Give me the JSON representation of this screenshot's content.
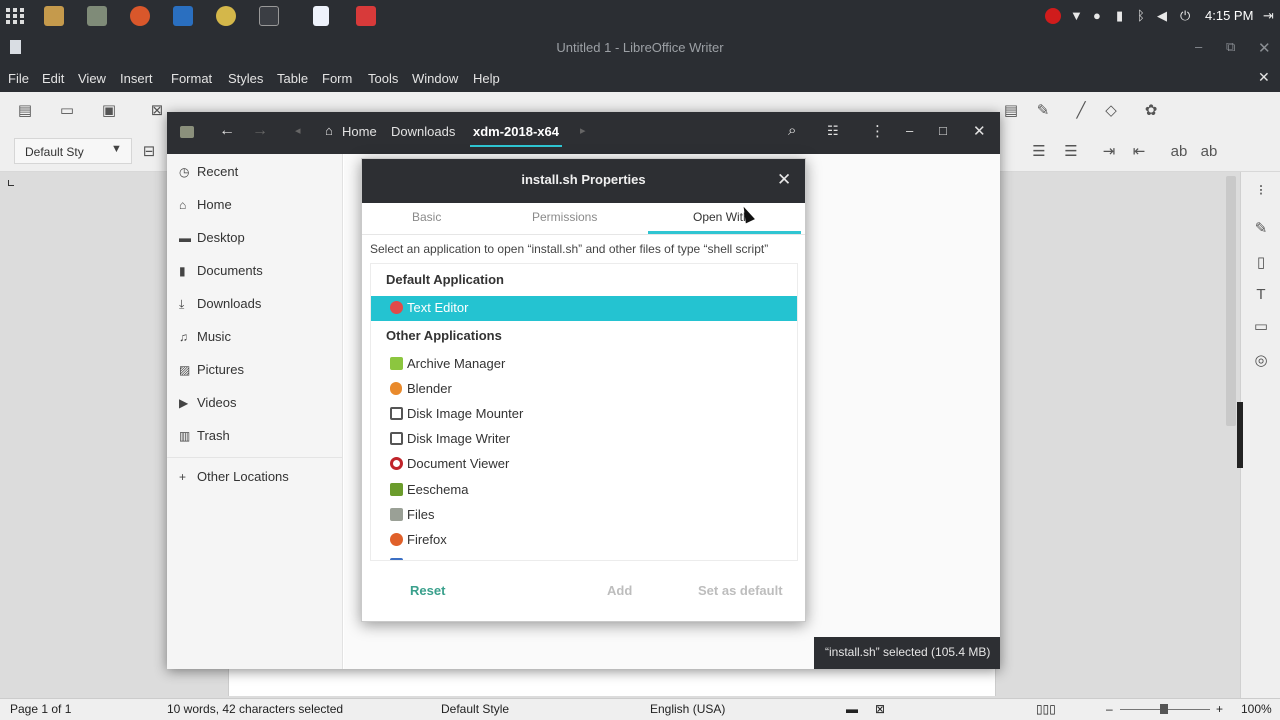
{
  "top_panel": {
    "clock": "4:15 PM"
  },
  "writer": {
    "title": "Untitled 1 - LibreOffice Writer",
    "menus": [
      "File",
      "Edit",
      "View",
      "Insert",
      "Format",
      "Styles",
      "Table",
      "Form",
      "Tools",
      "Window",
      "Help"
    ],
    "style_box": "Default Sty",
    "status": {
      "page": "Page 1 of 1",
      "words": "10 words, 42 characters selected",
      "style": "Default Style",
      "lang": "English (USA)",
      "zoom": "100%"
    }
  },
  "file_manager": {
    "breadcrumb": {
      "home": "Home",
      "downloads": "Downloads",
      "current": "xdm-2018-x64"
    },
    "sidebar": [
      {
        "label": "Recent",
        "icon": "clock-icon"
      },
      {
        "label": "Home",
        "icon": "home-icon"
      },
      {
        "label": "Desktop",
        "icon": "desktop-icon"
      },
      {
        "label": "Documents",
        "icon": "documents-icon"
      },
      {
        "label": "Downloads",
        "icon": "download-icon"
      },
      {
        "label": "Music",
        "icon": "music-icon"
      },
      {
        "label": "Pictures",
        "icon": "pictures-icon"
      },
      {
        "label": "Videos",
        "icon": "video-icon"
      },
      {
        "label": "Trash",
        "icon": "trash-icon"
      },
      {
        "label": "Other Locations",
        "icon": "plus-icon"
      }
    ],
    "status_pill": "“install.sh” selected  (105.4 MB)"
  },
  "dialog": {
    "title": "install.sh Properties",
    "tabs": [
      "Basic",
      "Permissions",
      "Open With"
    ],
    "active_tab": "Open With",
    "description": "Select an application to open “install.sh” and other files of type “shell script”",
    "default_heading": "Default Application",
    "default_app": "Text Editor",
    "other_heading": "Other Applications",
    "other_apps": [
      "Archive Manager",
      "Blender",
      "Disk Image Mounter",
      "Disk Image Writer",
      "Document Viewer",
      "Eeschema",
      "Files",
      "Firefox"
    ],
    "buttons": {
      "reset": "Reset",
      "add": "Add",
      "set_default": "Set as default"
    },
    "colors": {
      "accent": "#24c3d1",
      "reset": "#3aa08c"
    }
  }
}
